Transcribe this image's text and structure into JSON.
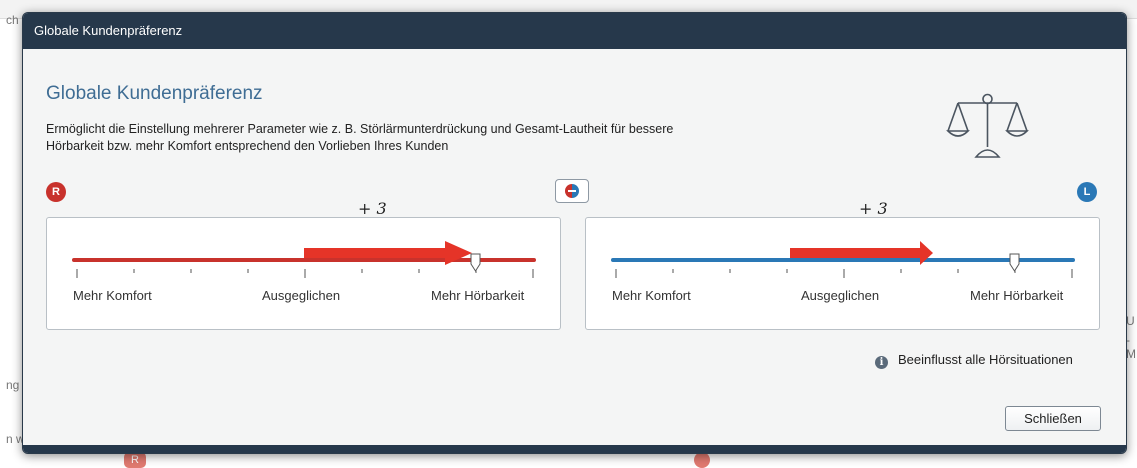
{
  "dialog": {
    "window_title": "Globale Kundenpräferenz",
    "heading": "Globale Kundenpräferenz",
    "description": "Ermöglicht die Einstellung mehrerer Parameter wie z. B. Störlärmunterdrückung und Gesamt-Lautheit für bessere Hörbarkeit bzw. mehr Komfort entsprechend den Vorlieben Ihres Kunden",
    "icons": {
      "scale": "scale-balance-icon",
      "link": "link-sides-icon",
      "info": "info-icon"
    },
    "right_side": {
      "badge": "R",
      "color": "#c8322c",
      "value_label": "+ 3",
      "arrow_color": "#e53428",
      "labels": {
        "left": "Mehr Komfort",
        "center": "Ausgeglichen",
        "right": "Mehr Hörbarkeit"
      }
    },
    "left_side": {
      "badge": "L",
      "color": "#2a78b6",
      "value_label": "+ 3",
      "arrow_color": "#e53428",
      "labels": {
        "left": "Mehr Komfort",
        "center": "Ausgeglichen",
        "right": "Mehr Hörbarkeit"
      }
    },
    "info_text": "Beeinflusst alle Hörsituationen",
    "close_label": "Schließen"
  },
  "background": {
    "left_fragment_top": "ch",
    "left_fragment_mid": "ng",
    "left_fragment_bottom": "n w",
    "right_fragment_1": "U",
    "right_fragment_2": "-M",
    "bottom_badge": "R"
  }
}
